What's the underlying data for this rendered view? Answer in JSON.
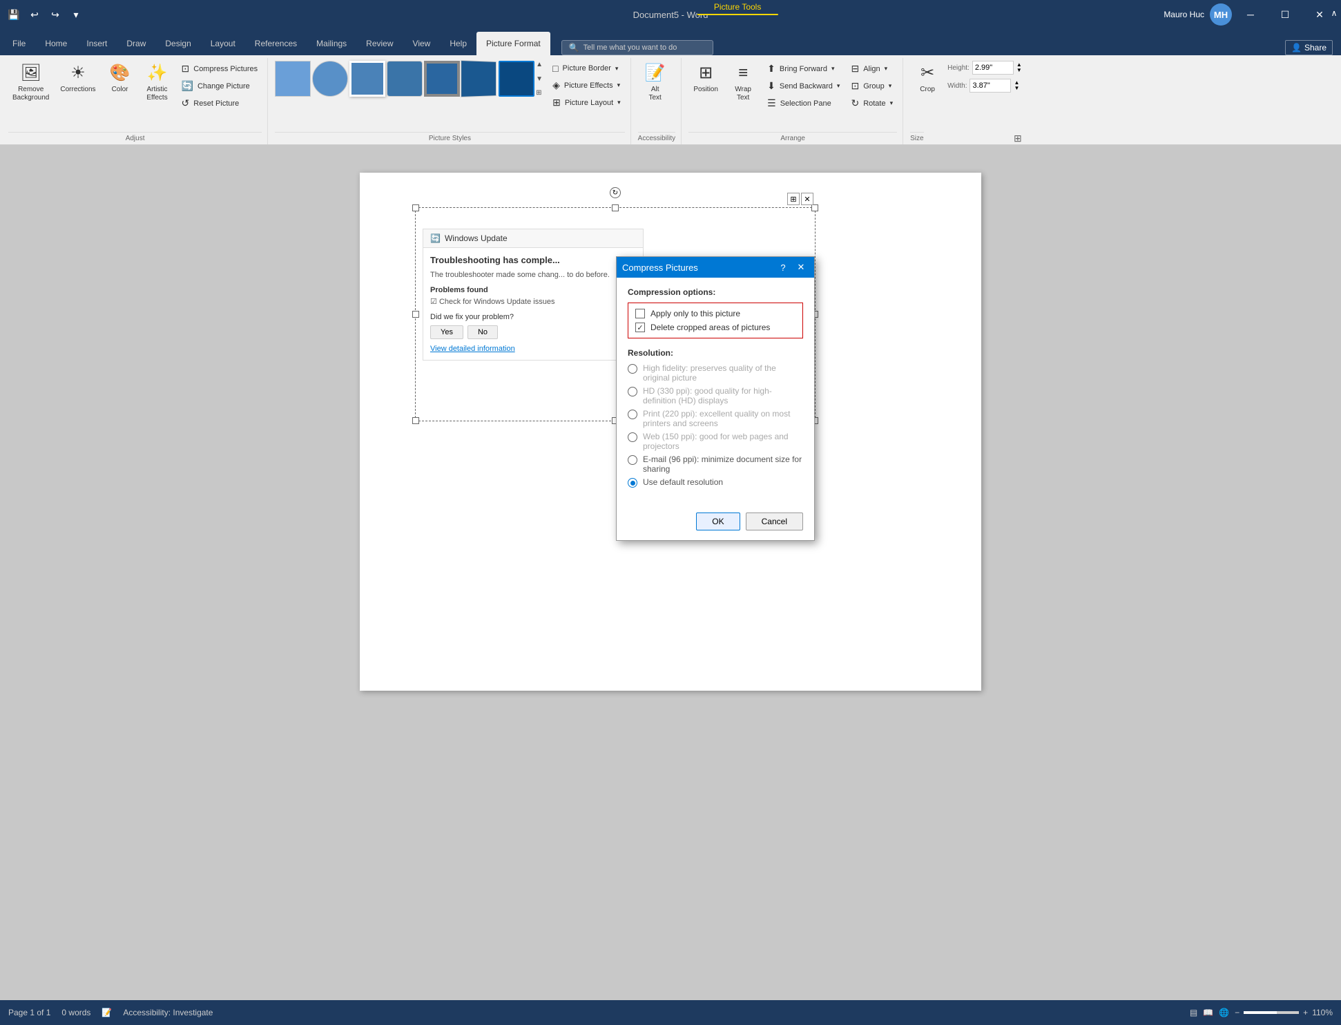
{
  "titlebar": {
    "doc_title": "Document5 - Word",
    "picture_tools_tab": "Picture Tools",
    "user_name": "Mauro Huc",
    "avatar_initials": "MH"
  },
  "tabs": {
    "items": [
      "File",
      "Home",
      "Insert",
      "Draw",
      "Design",
      "Layout",
      "References",
      "Mailings",
      "Review",
      "View",
      "Help",
      "Picture Format"
    ],
    "active": "Picture Format"
  },
  "ribbon": {
    "groups": {
      "adjust_label": "Adjust",
      "picture_styles_label": "Picture Styles",
      "accessibility_label": "Accessibility",
      "arrange_label": "Arrange",
      "size_label": "Size"
    },
    "buttons": {
      "remove_bg": "Remove\nBackground",
      "corrections": "Corrections",
      "color": "Color",
      "artistic_effects": "Artistic\nEffects",
      "compress_pictures": "Compress Pictures",
      "change_picture": "Change Picture",
      "reset_picture": "Reset Picture",
      "picture_border": "Picture Border",
      "picture_effects": "Picture Effects",
      "picture_layout": "Picture Layout",
      "alt_text": "Alt\nText",
      "position": "Position",
      "wrap_text": "Wrap\nText",
      "bring_forward": "Bring Forward",
      "send_backward": "Send Backward",
      "selection_pane": "Selection Pane",
      "align": "Align",
      "group": "Group",
      "rotate": "Rotate",
      "crop": "Crop",
      "height_label": "Height:",
      "height_val": "2.99\"",
      "width_label": "Width:",
      "width_val": "3.87\""
    }
  },
  "tellme": {
    "placeholder": "Tell me what you want to do"
  },
  "dialog": {
    "title": "Compress Pictures",
    "compression_section": "Compression options:",
    "option1_label": "Apply only to this picture",
    "option1_checked": false,
    "option2_label": "Delete cropped areas of pictures",
    "option2_checked": true,
    "resolution_section": "Resolution:",
    "resolutions": [
      {
        "label": "High fidelity: preserves quality of the original picture",
        "selected": false,
        "disabled": true
      },
      {
        "label": "HD (330 ppi): good quality for high-definition (HD) displays",
        "selected": false,
        "disabled": true
      },
      {
        "label": "Print (220 ppi): excellent quality on most printers and screens",
        "selected": false,
        "disabled": true
      },
      {
        "label": "Web (150 ppi): good for web pages and projectors",
        "selected": false,
        "disabled": true
      },
      {
        "label": "E-mail (96 ppi): minimize document size for sharing",
        "selected": false,
        "disabled": false
      },
      {
        "label": "Use default resolution",
        "selected": true,
        "disabled": false
      }
    ],
    "ok_btn": "OK",
    "cancel_btn": "Cancel"
  },
  "windows_update": {
    "header": "Windows Update",
    "title": "Troubleshooting has comple...",
    "desc": "The troubleshooter made some chang... to do before.",
    "section": "Problems found",
    "item": "Check for Windows Update issues",
    "question": "Did we fix your problem?",
    "yes_btn": "Yes",
    "no_btn": "No",
    "link": "View detailed information"
  },
  "statusbar": {
    "page_info": "Page 1 of 1",
    "words": "0 words",
    "accessibility": "Accessibility: Investigate",
    "zoom_level": "110%"
  },
  "share_btn": "Share"
}
